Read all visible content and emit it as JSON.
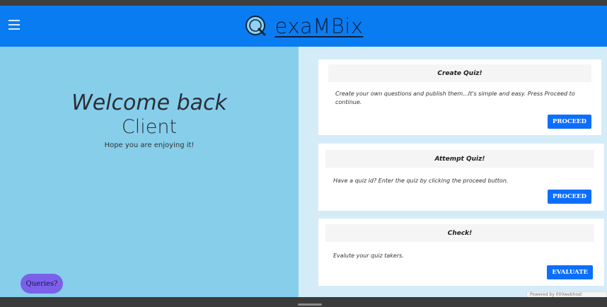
{
  "navbar": {
    "brand_text": "exaMBix",
    "brand_color": "#0a7cf2"
  },
  "icons": {
    "menu": "hamburger-menu-icon",
    "logo": "search-logo-icon"
  },
  "welcome": {
    "line1": "Welcome back",
    "line2": "Client",
    "line3": "Hope you are enjoying it!"
  },
  "queries_button": "Queries?",
  "cards": [
    {
      "title": "Create Quiz!",
      "description": "Create your own questions and publish them...It's simple and easy. Press Proceed to continue.",
      "button": "PROCEED"
    },
    {
      "title": "Attempt Quiz!",
      "description": "Have a quiz id? Enter the quiz by clicking the proceed button.",
      "button": "PROCEED"
    },
    {
      "title": "Check!",
      "description": "Evalute your quiz takers.",
      "button": "EVALUATE"
    }
  ],
  "powered_by": "Powered by 000webhost",
  "colors": {
    "left_panel": "#87ceeb",
    "right_panel": "#d4ecf7",
    "button": "#0d6efd",
    "queries": "#7b61ea"
  }
}
